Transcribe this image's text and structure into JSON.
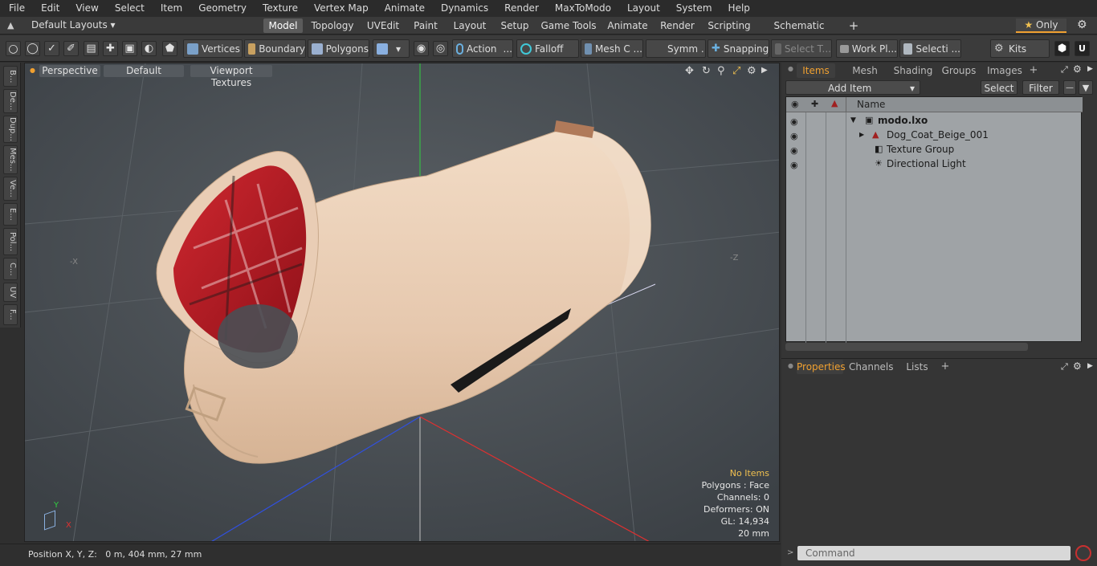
{
  "menu": [
    "File",
    "Edit",
    "View",
    "Select",
    "Item",
    "Geometry",
    "Texture",
    "Vertex Map",
    "Animate",
    "Dynamics",
    "Render",
    "MaxToModo",
    "Layout",
    "System",
    "Help"
  ],
  "layout": {
    "preset": "Default Layouts",
    "tabs": [
      "Model",
      "Topology",
      "UVEdit",
      "Paint",
      "Layout",
      "Setup",
      "Game Tools",
      "Animate",
      "Render",
      "Scripting",
      "Schematic Fusion"
    ],
    "add": "+",
    "only": "Only"
  },
  "toolbar": {
    "vertices": "Vertices",
    "boundary": "Boundary",
    "polygons": "Polygons",
    "action": "Action",
    "falloff": "Falloff",
    "mesh": "Mesh C ...",
    "symm": "Symm ...",
    "snapping": "Snapping",
    "select_t": "Select T...",
    "workplane": "Work Pl...",
    "selecti": "Selecti ...",
    "kits": "Kits"
  },
  "sidetabs": [
    "B...",
    "De...",
    "Dup...",
    "Mes...",
    "Ve...",
    "E...",
    "Pol...",
    "C...",
    "UV",
    "F..."
  ],
  "viewport": {
    "view": "Perspective",
    "shading": "Default",
    "textures": "Viewport Textures",
    "axis_y": "Y",
    "axis_x": "X",
    "neg_x": "-X",
    "neg_z": "-Z",
    "stats": {
      "selection": "No Items",
      "polygons": "Polygons : Face",
      "channels": "Channels: 0",
      "deformers": "Deformers: ON",
      "gl": "GL: 14,934",
      "scale": "20 mm"
    }
  },
  "status": {
    "position": "Position X, Y, Z:   0 m, 404 mm, 27 mm"
  },
  "items_panel": {
    "tabs": [
      "Items",
      "Mesh Ops",
      "Shading",
      "Groups",
      "Images"
    ],
    "add_item": "Add Item",
    "select": "Select",
    "filter": "Filter",
    "column_name": "Name",
    "items": [
      {
        "label": "modo.lxo",
        "depth": 0
      },
      {
        "label": "Dog_Coat_Beige_001",
        "depth": 1
      },
      {
        "label": "Texture Group",
        "depth": 1
      },
      {
        "label": "Directional Light",
        "depth": 1
      }
    ]
  },
  "properties_panel": {
    "tabs": [
      "Properties",
      "Channels",
      "Lists"
    ]
  },
  "command": {
    "placeholder": "Command"
  },
  "colors": {
    "accent": "#f0a030",
    "coat": "#e9cdb5",
    "lining": "#c0202a",
    "axis_x": "#e03030",
    "axis_y": "#30d040",
    "axis_z": "#3050e0"
  }
}
